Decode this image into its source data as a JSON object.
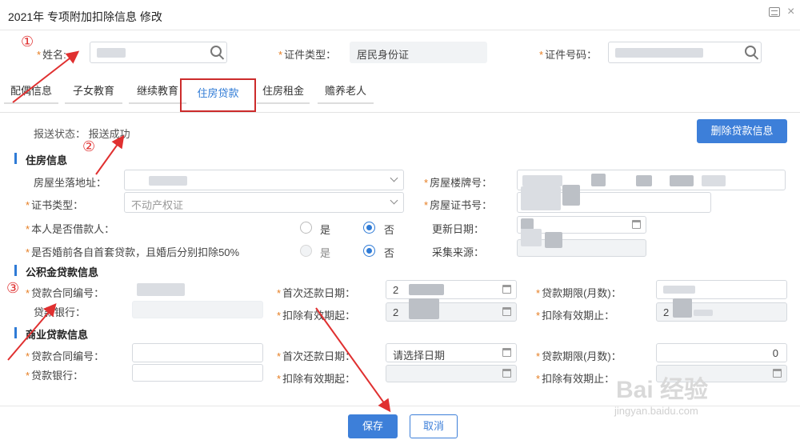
{
  "window": {
    "title": "2021年 专项附加扣除信息 修改",
    "close": "×"
  },
  "header": {
    "name_label": "姓名:",
    "id_type_label": "证件类型：",
    "id_type_value": "居民身份证",
    "id_number_label": "证件号码："
  },
  "tabs": [
    "配偶信息",
    "子女教育",
    "继续教育",
    "住房贷款",
    "住房租金",
    "赡养老人"
  ],
  "active_tab": "住房贷款",
  "status": {
    "text": "报送状态：  报送成功"
  },
  "delete_button": "删除贷款信息",
  "house_section": {
    "title": "住房信息",
    "address_label": "房屋坐落地址：",
    "plate_label": "房屋楼牌号：",
    "cert_type_label": "证书类型：",
    "cert_type_value": "不动产权证",
    "cert_no_label": "房屋证书号：",
    "borrower_label": "本人是否借款人：",
    "yes": "是",
    "no": "否",
    "update_date_label": "更新日期：",
    "premarital_label": "是否婚前各自首套贷款，且婚后分别扣除50%",
    "source_label": "采集来源："
  },
  "fund_section": {
    "title": "公积金贷款信息",
    "contract_label": "贷款合同编号：",
    "first_repay_label": "首次还款日期：",
    "term_label": "贷款期限(月数)：",
    "bank_label": "贷款银行：",
    "deduct_start_label": "扣除有效期起：",
    "deduct_end_label": "扣除有效期止：",
    "first_repay_prefix": "2",
    "deduct_start_prefix": "2",
    "deduct_end_prefix": "2"
  },
  "commercial_section": {
    "title": "商业贷款信息",
    "contract_label": "贷款合同编号：",
    "first_repay_label": "首次还款日期：",
    "first_repay_placeholder": "请选择日期",
    "term_label": "贷款期限(月数)：",
    "term_value": "0",
    "bank_label": "贷款银行：",
    "deduct_start_label": "扣除有效期起：",
    "deduct_end_label": "扣除有效期止："
  },
  "footer": {
    "save": "保存",
    "cancel": "取消"
  },
  "annotations": {
    "one": "①",
    "two": "②",
    "three": "③"
  },
  "watermark": {
    "logo": "Bai 经验",
    "url": "jingyan.baidu.com"
  },
  "colors": {
    "accent": "#3d7fd9",
    "annotation": "#e03030",
    "highlight_border": "#cc2b2b"
  }
}
